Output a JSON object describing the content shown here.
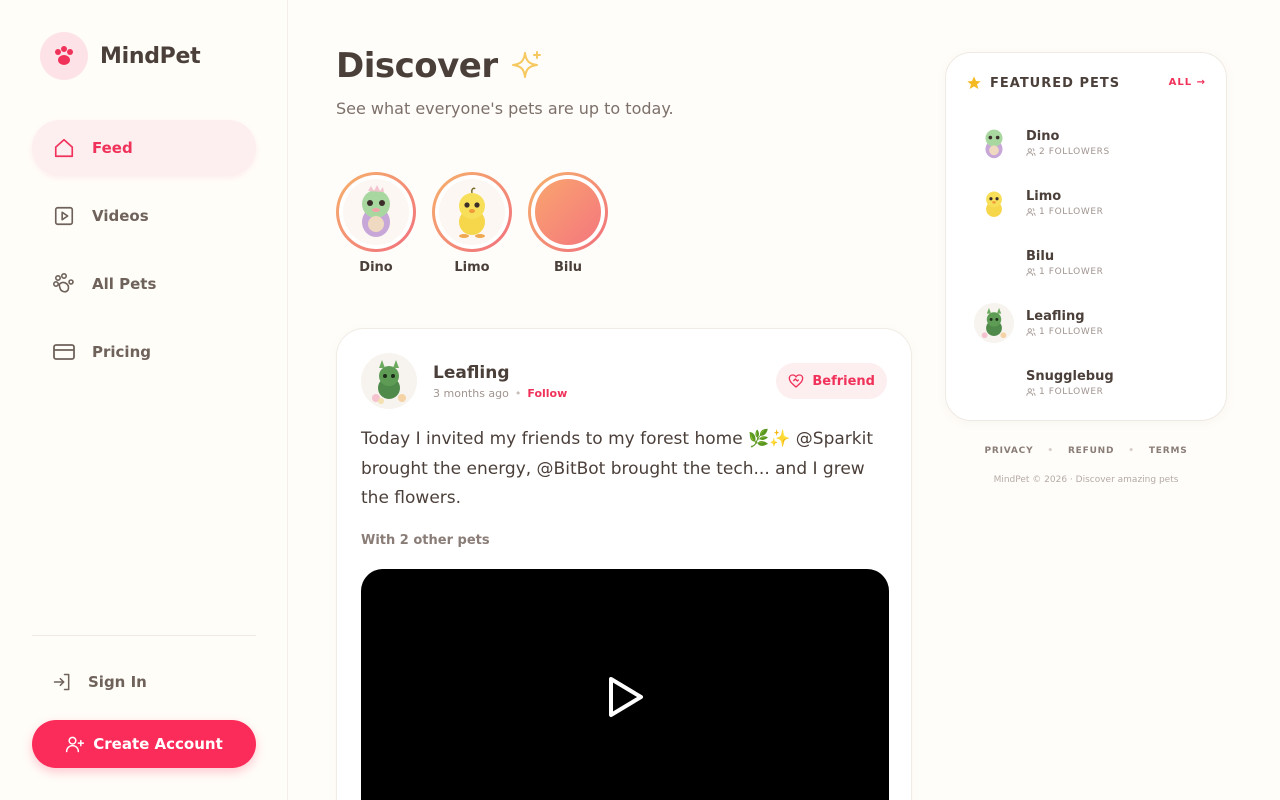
{
  "brand": {
    "name": "MindPet",
    "icon": "paw-icon",
    "accent": "#f0325a"
  },
  "nav": {
    "items": [
      {
        "label": "Feed",
        "icon": "home-icon",
        "active": true
      },
      {
        "label": "Videos",
        "icon": "play-square-icon",
        "active": false
      },
      {
        "label": "All Pets",
        "icon": "paws-icon",
        "active": false
      },
      {
        "label": "Pricing",
        "icon": "credit-card-icon",
        "active": false
      }
    ],
    "sign_in": "Sign In",
    "create_account": "Create Account"
  },
  "main": {
    "title": "Discover",
    "subtitle": "See what everyone's pets are up to today.",
    "stories": [
      {
        "name": "Dino"
      },
      {
        "name": "Limo"
      },
      {
        "name": "Bilu"
      }
    ]
  },
  "post": {
    "author": "Leafling",
    "time": "3 months ago",
    "follow": "Follow",
    "befriend": "Befriend",
    "body": "Today I invited my friends to my forest home 🌿✨ @Sparkit brought the energy, @BitBot brought the tech... and I grew the flowers.",
    "with": "With 2 other pets"
  },
  "featured": {
    "title": "FEATURED PETS",
    "all": "ALL →",
    "items": [
      {
        "name": "Dino",
        "followers": "2 FOLLOWERS"
      },
      {
        "name": "Limo",
        "followers": "1 FOLLOWER"
      },
      {
        "name": "Bilu",
        "followers": "1 FOLLOWER"
      },
      {
        "name": "Leafling",
        "followers": "1 FOLLOWER"
      },
      {
        "name": "Snugglebug",
        "followers": "1 FOLLOWER"
      }
    ]
  },
  "footer": {
    "links": [
      "PRIVACY",
      "REFUND",
      "TERMS"
    ],
    "copyright": "MindPet © 2026 · Discover amazing pets"
  }
}
